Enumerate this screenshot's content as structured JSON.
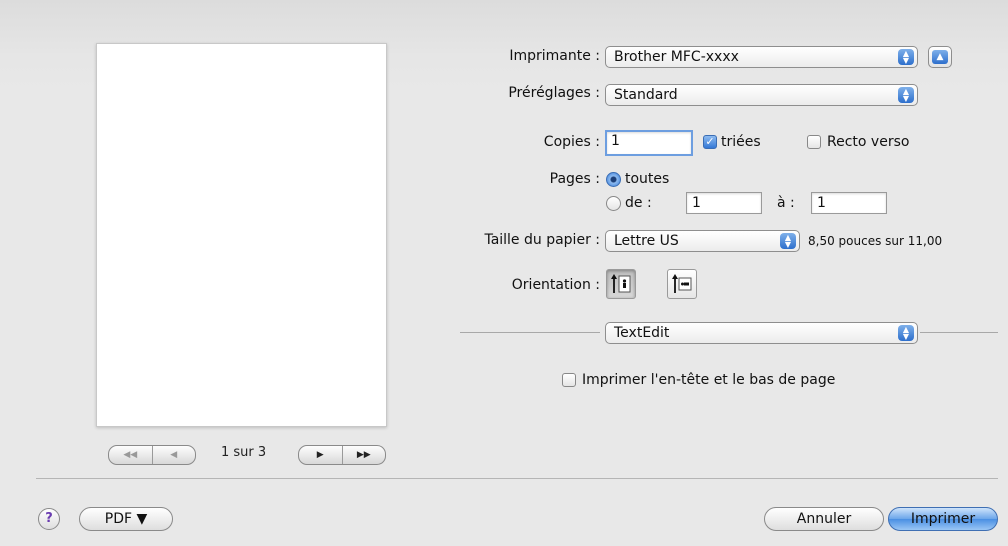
{
  "preview": {
    "page_indicator": "1 sur 3",
    "first_btn": "◀◀",
    "prev_btn": "◀",
    "next_btn": "▶",
    "last_btn": "▶▶"
  },
  "printer": {
    "label": "Imprimante :",
    "value": "Brother MFC-xxxx",
    "collapse_icon": "▲"
  },
  "presets": {
    "label": "Préréglages :",
    "value": "Standard"
  },
  "copies": {
    "label": "Copies :",
    "value": "1",
    "collated_label": "triées",
    "collated_checked": true,
    "duplex_label": "Recto verso",
    "duplex_checked": false
  },
  "pages": {
    "label": "Pages :",
    "all_label": "toutes",
    "range_label": "de :",
    "from": "1",
    "to_label": "à :",
    "to": "1"
  },
  "paper_size": {
    "label": "Taille du papier :",
    "value": "Lettre US",
    "dimensions": "8,50 pouces sur 11,00"
  },
  "orientation": {
    "label": "Orientation :",
    "portrait_icon": "portrait-orientation-icon",
    "landscape_icon": "landscape-orientation-icon",
    "selected": "portrait"
  },
  "section": {
    "value": "TextEdit"
  },
  "header_footer": {
    "label": "Imprimer l'en-tête et le bas de page",
    "checked": false
  },
  "footer": {
    "help": "?",
    "pdf": "PDF ▼",
    "cancel": "Annuler",
    "print": "Imprimer"
  },
  "colors": {
    "accent": "#3478d6",
    "default_button": "#6aa5ea",
    "window_bg": "#e8e8e8"
  }
}
